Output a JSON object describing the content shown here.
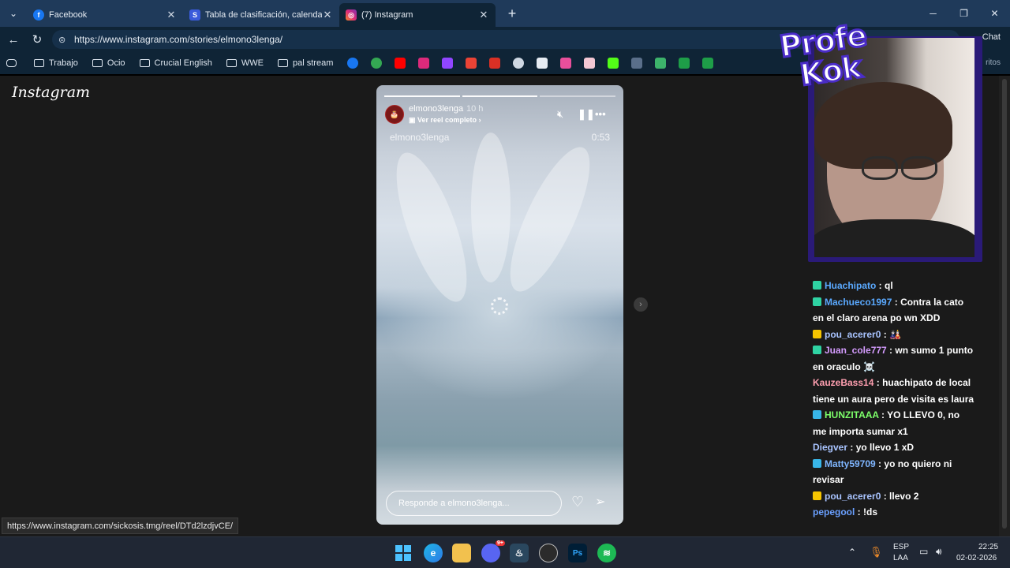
{
  "browser": {
    "tabs": [
      {
        "title": "Facebook",
        "favicon": "facebook-icon",
        "active": false
      },
      {
        "title": "Tabla de clasificación, calendario y",
        "favicon": "stats-icon",
        "active": false
      },
      {
        "title": "(7) Instagram",
        "favicon": "instagram-icon",
        "active": true
      }
    ],
    "url": "https://www.instagram.com/stories/elmono3lenga/",
    "chat_button": "Chat",
    "bookmarks": [
      "Trabajo",
      "Ocio",
      "Crucial English",
      "WWE",
      "pal stream"
    ],
    "bookmarks_right": "ritos",
    "status_link": "https://www.instagram.com/sickosis.tmg/reel/DTd2lzdjvCE/"
  },
  "page": {
    "logo": "Instagram",
    "story": {
      "username": "elmono3lenga",
      "time_ago": "10 h",
      "reel_link": "Ver reel completo",
      "overlay_username": "elmono3lenga",
      "duration": "0:53",
      "reply_placeholder": "Responde a elmono3lenga..."
    }
  },
  "stream": {
    "logo_line1": "Profe",
    "logo_line2": "Kok",
    "chat": [
      {
        "badge_color": "#2fd3a3",
        "user": "Huachipato",
        "user_color": "#5aa9ff",
        "text": "ql"
      },
      {
        "badge_color": "#2fd3a3",
        "user": "Machueco1997",
        "user_color": "#5aa9ff",
        "text": "Contra la cato en el claro arena po wn XDD"
      },
      {
        "badge_color": "#f5c400",
        "user": "pou_acerer0",
        "user_color": "#a9c4ff",
        "text": "🎎"
      },
      {
        "badge_color": "#2fd3a3",
        "user": "Juan_cole777",
        "user_color": "#d59cff",
        "text": "wn sumo 1 punto en oraculo ☠️"
      },
      {
        "badge_color": "",
        "user": "KauzeBass14",
        "user_color": "#ff9fb0",
        "text": "huachipato de local tiene un aura pero de visita es laura"
      },
      {
        "badge_color": "#38b6e8",
        "user": "HUNZITAAA",
        "user_color": "#7dff6a",
        "text": "YO LLEVO 0, no me importa sumar x1"
      },
      {
        "badge_color": "",
        "user": "Diegver",
        "user_color": "#a9c4ff",
        "text": "yo llevo 1 xD"
      },
      {
        "badge_color": "#38b6e8",
        "user": "Matty59709",
        "user_color": "#7fb6ff",
        "text": "yo no quiero ni revisar"
      },
      {
        "badge_color": "#f5c400",
        "user": "pou_acerer0",
        "user_color": "#a9c4ff",
        "text": "llevo 2"
      },
      {
        "badge_color": "",
        "user": "pepegool",
        "user_color": "#6aa0ff",
        "text": "!ds"
      }
    ]
  },
  "taskbar": {
    "language": "ESP",
    "layout": "LAA",
    "time": "22:25",
    "date": "02-02-2026",
    "discord_badge": "9+"
  }
}
